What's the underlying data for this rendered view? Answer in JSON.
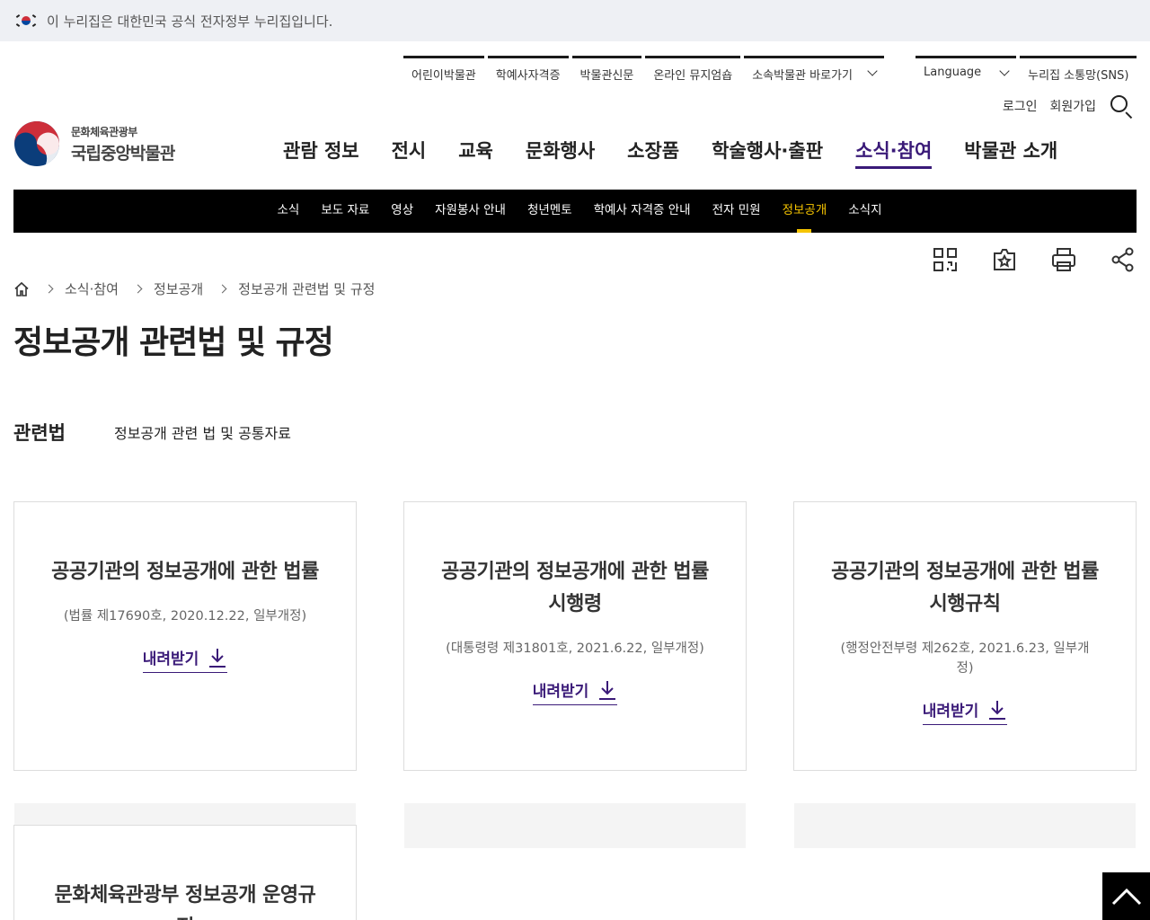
{
  "gov_banner": {
    "text": "이 누리집은 대한민국 공식 전자정부 누리집입니다."
  },
  "utility": {
    "links": [
      "어린이박물관",
      "학예사자격증",
      "박물관신문",
      "온라인 뮤지엄숍"
    ],
    "affiliates_label": "소속박물관 바로가기",
    "language_label": "Language",
    "sns_label": "누리집 소통망(SNS)",
    "login_label": "로그인",
    "signup_label": "회원가입"
  },
  "logo": {
    "ministry": "문화체육관광부",
    "name": "국립중앙박물관"
  },
  "gnb": [
    "관람 정보",
    "전시",
    "교육",
    "문화행사",
    "소장품",
    "학술행사·출판",
    "소식·참여",
    "박물관 소개"
  ],
  "gnb_active_index": 6,
  "subnav": [
    "소식",
    "보도 자료",
    "영상",
    "자원봉사 안내",
    "청년멘토",
    "학예사 자격증 안내",
    "전자 민원",
    "정보공개",
    "소식지"
  ],
  "subnav_active_index": 7,
  "tools": [
    "qr-code-icon",
    "bookmark-star-icon",
    "print-icon",
    "share-icon"
  ],
  "breadcrumb": [
    "소식·참여",
    "정보공개",
    "정보공개 관련법 및 규정"
  ],
  "page_title": "정보공개 관련법 및 규정",
  "law_tabs": {
    "active": "관련법",
    "other": "정보공개 관련 법 및 공통자료"
  },
  "cards": [
    {
      "title": "공공기관의 정보공개에 관한 법률",
      "meta": "(법률 제17690호, 2020.12.22, 일부개정)",
      "download": "내려받기"
    },
    {
      "title": "공공기관의 정보공개에 관한 법률 시행령",
      "meta": "(대통령령 제31801호, 2021.6.22, 일부개정)",
      "download": "내려받기"
    },
    {
      "title": "공공기관의 정보공개에 관한 법률 시행규칙",
      "meta": "(행정안전부령 제262호, 2021.6.23, 일부개정)",
      "download": "내려받기"
    },
    {
      "title": "문화체육관광부 정보공개 운영규정",
      "meta": "",
      "download": ""
    }
  ],
  "colors": {
    "accent": "#3a1a78",
    "subnav_active": "#f5c400",
    "subnav_bg": "#000000",
    "banner_bg": "#eef0f4"
  }
}
